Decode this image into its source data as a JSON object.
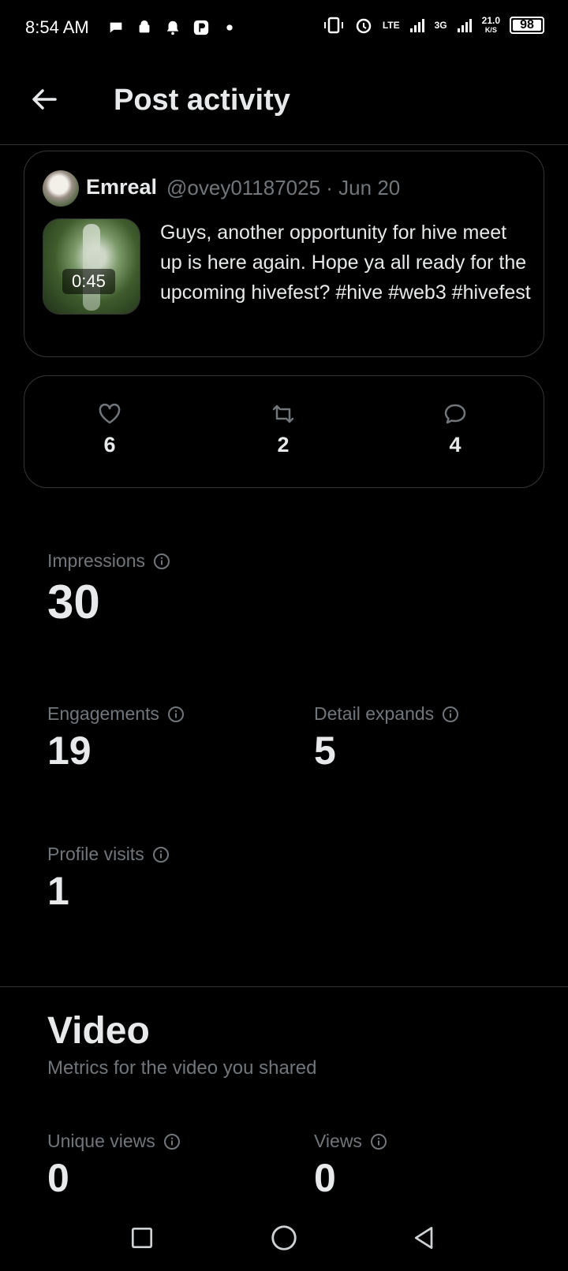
{
  "status_bar": {
    "time": "8:54 AM",
    "lte": "LTE",
    "net3g": "3G",
    "speed_value": "21.0",
    "speed_unit": "K/S",
    "battery": "98"
  },
  "header": {
    "title": "Post activity"
  },
  "post": {
    "author_name": "Emreal",
    "handle_date": "@ovey01187025 · Jun 20",
    "video_duration": "0:45",
    "text": "Guys, another opportunity for hive meet up is here again. Hope ya all ready for the upcoming hivefest? #hive #web3 #hivefest"
  },
  "engagement": {
    "likes": "6",
    "reposts": "2",
    "replies": "4"
  },
  "metrics": {
    "impressions": {
      "label": "Impressions",
      "value": "30"
    },
    "engagements": {
      "label": "Engagements",
      "value": "19"
    },
    "detail_expands": {
      "label": "Detail expands",
      "value": "5"
    },
    "profile_visits": {
      "label": "Profile visits",
      "value": "1"
    }
  },
  "video_section": {
    "title": "Video",
    "subtitle": "Metrics for the video you shared",
    "unique_views": {
      "label": "Unique views",
      "value": "0"
    },
    "views": {
      "label": "Views",
      "value": "0"
    }
  },
  "colors": {
    "background": "#000000",
    "primary_text": "#e7e9ea",
    "secondary_text": "#71767b",
    "border": "#333639"
  }
}
